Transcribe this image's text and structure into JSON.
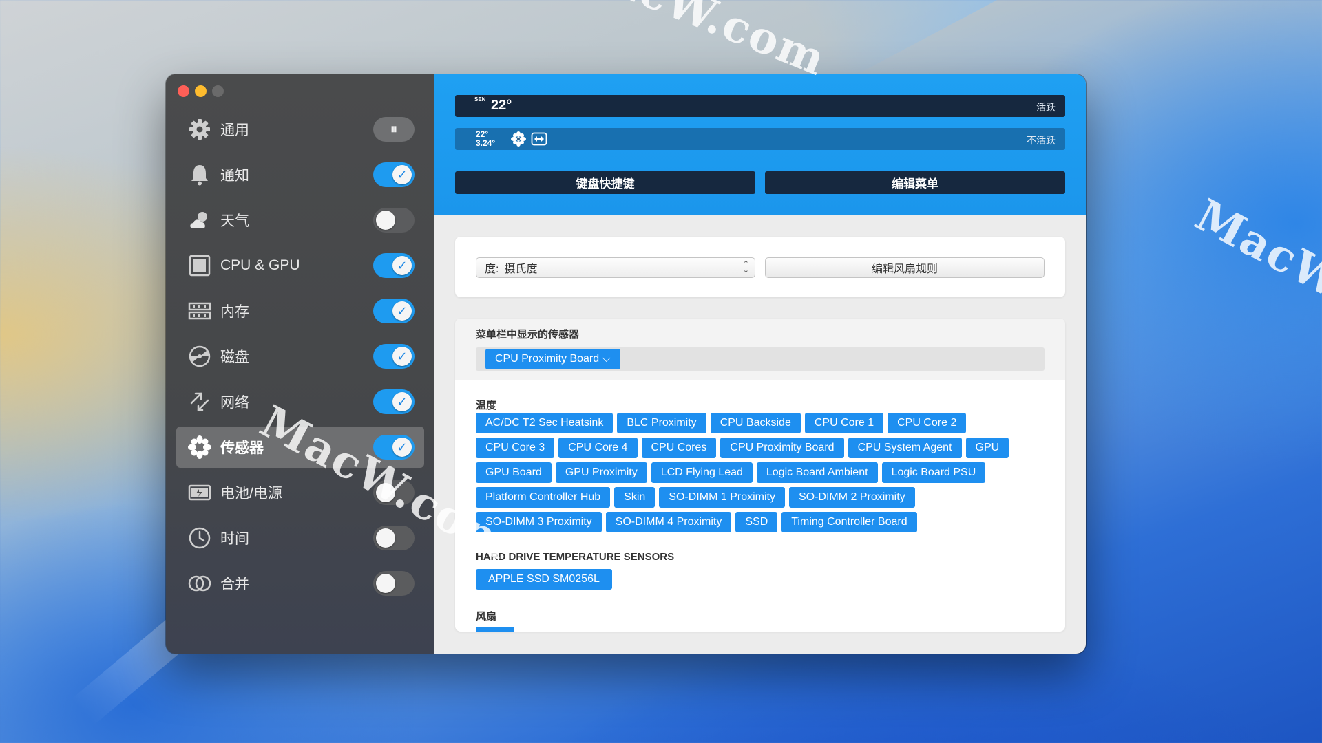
{
  "window": {
    "sidebar": {
      "items": [
        {
          "label": "通用",
          "icon": "gear-icon",
          "toggle": "pause",
          "active": false
        },
        {
          "label": "通知",
          "icon": "bell-icon",
          "toggle": "on",
          "active": false
        },
        {
          "label": "天气",
          "icon": "weather-icon",
          "toggle": "off",
          "active": false
        },
        {
          "label": "CPU & GPU",
          "icon": "chip-icon",
          "toggle": "on",
          "active": false
        },
        {
          "label": "内存",
          "icon": "memory-icon",
          "toggle": "on",
          "active": false
        },
        {
          "label": "磁盘",
          "icon": "disk-icon",
          "toggle": "on",
          "active": false
        },
        {
          "label": "网络",
          "icon": "network-icon",
          "toggle": "on",
          "active": false
        },
        {
          "label": "传感器",
          "icon": "sensor-fan-icon",
          "toggle": "on",
          "active": true
        },
        {
          "label": "电池/电源",
          "icon": "battery-icon",
          "toggle": "off",
          "active": false
        },
        {
          "label": "时间",
          "icon": "clock-icon",
          "toggle": "off",
          "active": false
        },
        {
          "label": "合并",
          "icon": "combine-icon",
          "toggle": "off",
          "active": false
        }
      ],
      "pause_glyph": "⏸",
      "check_glyph": "✓"
    },
    "header": {
      "active_bar": {
        "vertical_label": "SEN",
        "temp": "22°",
        "state": "活跃"
      },
      "inactive_bar": {
        "temp_line1": "22°",
        "temp_line2": "3.24°",
        "state": "不活跃"
      },
      "keyboard_shortcut_button": "键盘快捷键",
      "edit_menu_button": "编辑菜单"
    },
    "units": {
      "select_prefix": "度:",
      "select_value": "摄氏度",
      "edit_fan_rules_button": "编辑风扇规则"
    },
    "sensors": {
      "menubar_title": "菜单栏中显示的传感器",
      "menubar_selected": "CPU Proximity Board ⌵",
      "temperature_title": "温度",
      "temperature_chips": [
        "AC/DC T2 Sec Heatsink",
        "BLC Proximity",
        "CPU Backside",
        "CPU Core 1",
        "CPU Core 2",
        "CPU Core 3",
        "CPU Core 4",
        "CPU Cores",
        "CPU Proximity Board",
        "CPU System Agent",
        "GPU",
        "GPU Board",
        "GPU Proximity",
        "LCD Flying Lead",
        "Logic Board Ambient",
        "Logic Board PSU",
        "Platform Controller Hub",
        "Skin",
        "SO-DIMM 1 Proximity",
        "SO-DIMM 2 Proximity",
        "SO-DIMM 3 Proximity",
        "SO-DIMM 4 Proximity",
        "SSD",
        "Timing Controller Board"
      ],
      "hard_drive_title": "HARD DRIVE TEMPERATURE SENSORS",
      "hard_drive_chip": "APPLE SSD SM0256L",
      "fan_title": "风扇"
    },
    "colors": {
      "accent": "#1e8ff0",
      "header_blue": "#1fa0f2",
      "dark_bar": "#16283f"
    }
  },
  "watermark": "MacW.com"
}
